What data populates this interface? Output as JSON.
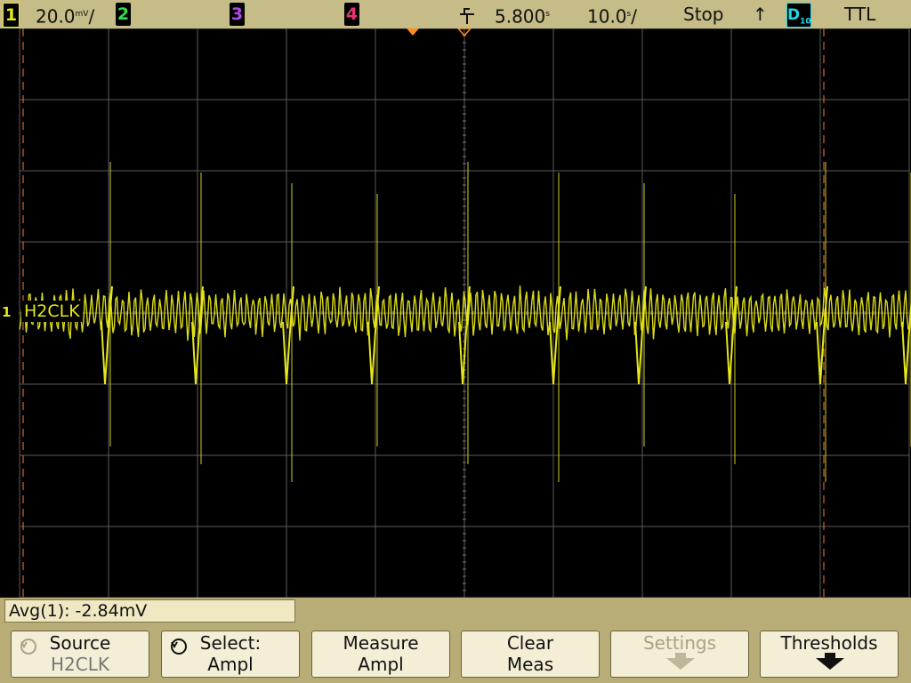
{
  "status": {
    "ch1_num": "1",
    "ch1_scale": "20.0",
    "ch1_unit": "mV",
    "ch1_per": "/",
    "ch2_num": "2",
    "ch3_num": "3",
    "ch4_num": "4",
    "delay_value": "5.800",
    "delay_unit": "s",
    "timebase_value": "10.0",
    "timebase_unit": "s",
    "timebase_per": "/",
    "run_state": "Stop",
    "trigger_slope": "↑",
    "digital_label": "D",
    "digital_sub": "10",
    "threshold": "TTL"
  },
  "screen": {
    "channel_marker": "1",
    "channel_label": "H2CLK"
  },
  "measurement": {
    "text": "Avg(1): -2.84mV"
  },
  "softkeys": [
    {
      "line1": "Source",
      "line2": "H2CLK"
    },
    {
      "line1": "Select:",
      "line2": "Ampl"
    },
    {
      "line1": "Measure",
      "line2": "Ampl"
    },
    {
      "line1": "Clear",
      "line2": "Meas"
    },
    {
      "line1": "Settings",
      "line2": ""
    },
    {
      "line1": "Thresholds",
      "line2": ""
    }
  ],
  "colors": {
    "ch1": "#e6e61a",
    "ch2": "#2ee04a",
    "ch3": "#b04ae6",
    "ch4": "#e6356e",
    "digital": "#22d6e6",
    "trigger_marker": "#ff8c1a",
    "cursor": "#ff7a30"
  }
}
